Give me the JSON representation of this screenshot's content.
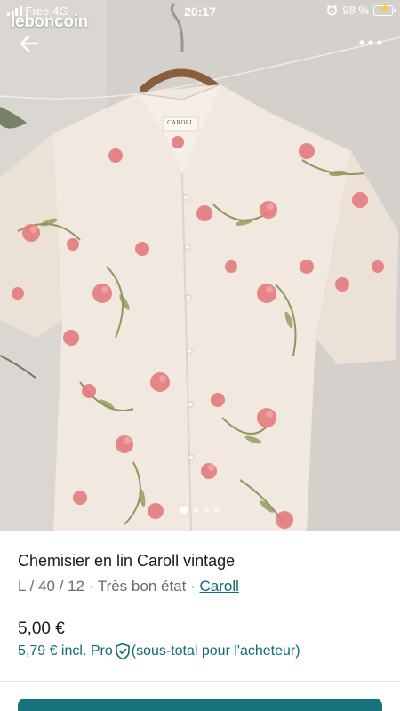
{
  "status_bar": {
    "carrier": "Free",
    "network": "4G",
    "time": "20:17",
    "battery": "98 %",
    "battery_level": 0.98
  },
  "app": {
    "logo": "leboncoin",
    "back_icon": "arrow-left-icon",
    "more_icon": "more-horizontal-icon"
  },
  "gallery": {
    "image_count": 4,
    "current_index": 1
  },
  "listing": {
    "title": "Chemisier en lin Caroll vintage",
    "size": "L / 40 / 12",
    "separator": "·",
    "condition": "Très bon état",
    "brand": "Caroll",
    "label_brand_on_shirt": "CAROLL",
    "price": "5,00 €",
    "pro_price": "5,79 € incl. Pro",
    "pro_note": "(sous-total pour l'acheteur)"
  },
  "colors": {
    "accent": "#0e6c73",
    "button": "#17737a",
    "battery_fill": "#4cd964"
  }
}
